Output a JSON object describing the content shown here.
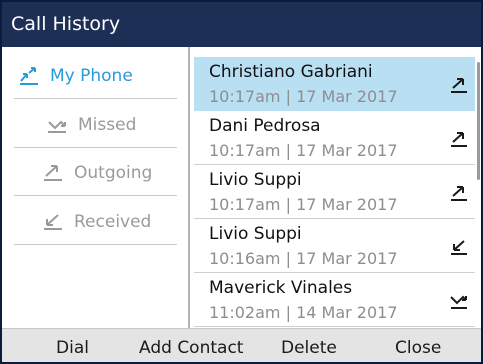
{
  "title": "Call History",
  "sidebar": {
    "items": [
      {
        "label": "My Phone",
        "icon": "my-phone-calls-icon",
        "active": true
      },
      {
        "label": "Missed",
        "icon": "missed-call-icon",
        "active": false
      },
      {
        "label": "Outgoing",
        "icon": "outgoing-call-icon",
        "active": false
      },
      {
        "label": "Received",
        "icon": "received-call-icon",
        "active": false
      }
    ]
  },
  "calls": [
    {
      "name": "Christiano Gabriani",
      "meta": "10:17am | 17 Mar 2017",
      "type": "outgoing",
      "icon": "outgoing-call-icon",
      "selected": true
    },
    {
      "name": "Dani Pedrosa",
      "meta": "10:17am | 17 Mar 2017",
      "type": "outgoing",
      "icon": "outgoing-call-icon",
      "selected": false
    },
    {
      "name": "Livio Suppi",
      "meta": "10:17am | 17 Mar 2017",
      "type": "outgoing",
      "icon": "outgoing-call-icon",
      "selected": false
    },
    {
      "name": "Livio Suppi",
      "meta": "10:16am | 17 Mar 2017",
      "type": "received",
      "icon": "received-call-icon",
      "selected": false
    },
    {
      "name": "Maverick Vinales",
      "meta": "11:02am | 14 Mar 2017",
      "type": "missed",
      "icon": "missed-call-icon",
      "selected": false
    }
  ],
  "softkeys": {
    "dial": "Dial",
    "add_contact": "Add Contact",
    "delete": "Delete",
    "close": "Close"
  },
  "colors": {
    "titlebar": "#1d2f55",
    "accent": "#2a9ad8",
    "selected_row": "#b9dff3",
    "softkey_bar": "#e4e4e4"
  }
}
